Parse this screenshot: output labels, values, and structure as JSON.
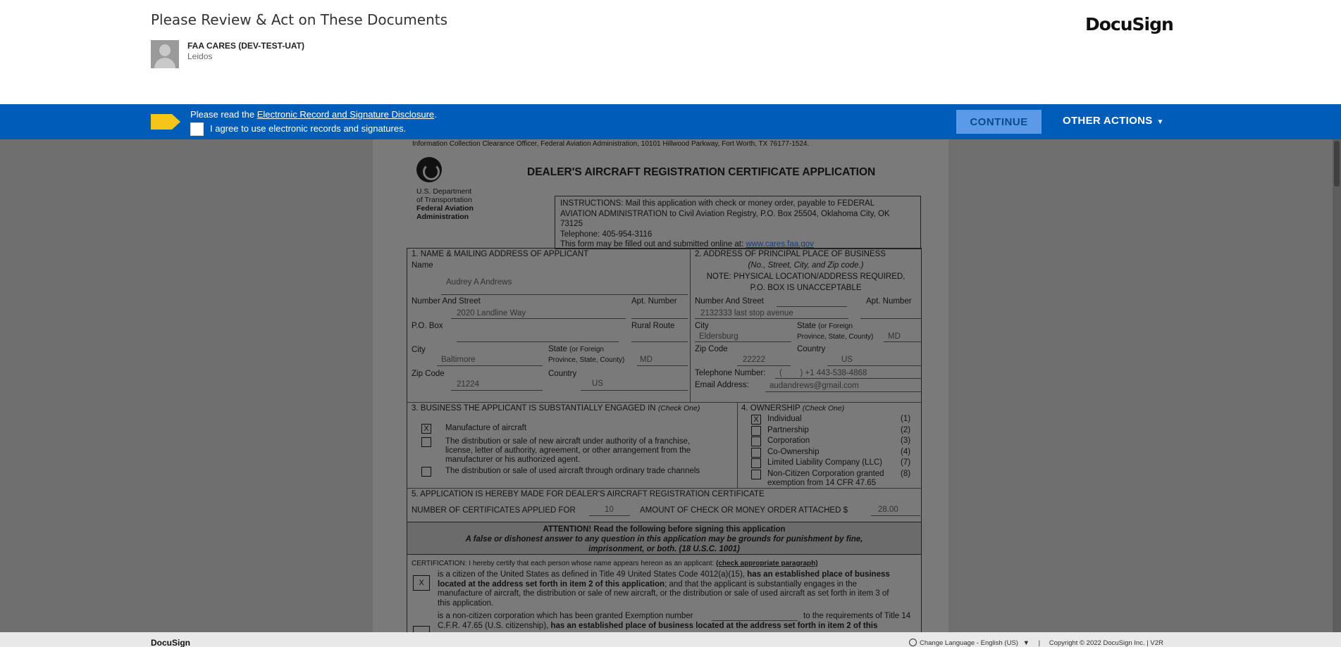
{
  "header": {
    "title": "Please Review & Act on These Documents",
    "sender_name": "FAA CARES (DEV-TEST-UAT)",
    "sender_org": "Leidos",
    "logo": "DocuSign"
  },
  "bar": {
    "read_prefix": "Please read the ",
    "disclosure_link": "Electronic Record and Signature Disclosure",
    "read_suffix": ".",
    "agree_label": "I agree to use electronic records and signatures.",
    "continue_label": "CONTINUE",
    "other_actions_label": "OTHER ACTIONS",
    "caret": "▼",
    "colors": {
      "bar": "#005cb9",
      "tag": "#f5c518"
    }
  },
  "document": {
    "info_line": "Information Collection Clearance Officer, Federal Aviation Administration, 10101 Hillwood Parkway, Fort Worth, TX 76177-1524.",
    "dept_line1": "U.S. Department",
    "dept_line2": "of Transportation",
    "dept_line3": "Federal Aviation",
    "dept_line4": "Administration",
    "title": "DEALER'S AIRCRAFT REGISTRATION CERTIFICATE APPLICATION",
    "instructions_1": "INSTRUCTIONS: Mail this application with check or money order, payable to FEDERAL",
    "instructions_2": "AVIATION ADMINISTRATION to Civil Aviation Registry, P.O. Box 25504, Oklahoma City, OK",
    "instructions_3": "73125",
    "telephone": "Telephone: 405-954-3116",
    "online_prefix": "This form may be filled out and submitted online at: ",
    "online_url": "www.cares.faa.gov",
    "s1": {
      "heading": "1.     NAME & MAILING ADDRESS OF APPLICANT",
      "name_label": "Name",
      "name_value": "Audrey A Andrews",
      "street_label": "Number And Street",
      "apt_label": "Apt. Number",
      "street_value": "2020 Landline Way",
      "pobox_label": "P.O. Box",
      "rural_label": "Rural Route",
      "city_label": "City",
      "city_value": "Baltimore",
      "state_label": "State",
      "state_sub1": "(or Foreign",
      "state_sub2": "Province, State, County)",
      "state_value": "MD",
      "zip_label": "Zip Code",
      "zip_value": "21224",
      "country_label": "Country",
      "country_value": "US"
    },
    "s2": {
      "heading": "2.     ADDRESS OF PRINCIPAL PLACE OF BUSINESS",
      "sub": "(No., Street, City, and Zip code.)",
      "note1": "NOTE: PHYSICAL LOCATION/ADDRESS REQUIRED,",
      "note2": "P.O. BOX IS UNACCEPTABLE",
      "street_label": "Number And Street",
      "apt_label": "Apt. Number",
      "street_value": "2132333 last stop avenue",
      "city_label": "City",
      "city_value": "Eldersburg",
      "state_label": "State",
      "state_sub1": "(or Foreign",
      "state_sub2": "Province, State, County)",
      "state_value": "MD",
      "zip_label": "Zip Code",
      "zip_value": "22222",
      "country_label": "Country",
      "country_value": "US",
      "phone_label": "Telephone Number:",
      "phone_value": "(        ) +1 443-538-4868",
      "email_label": "Email Address:",
      "email_value": "audandrews@gmail.com"
    },
    "s3": {
      "heading": "3.     BUSINESS THE APPLICANT IS SUBSTANTIALLY ENGAGED IN",
      "check_one": "(Check One)",
      "opt1": "Manufacture of aircraft",
      "opt1_mark": "X",
      "opt2_1": "The distribution or sale of new aircraft under authority of a franchise,",
      "opt2_2": "license, letter of authority, agreement, or other arrangement from the",
      "opt2_3": "manufacturer or his authorized agent.",
      "opt3": "The distribution or sale of used aircraft through ordinary trade channels"
    },
    "s4": {
      "heading": "4.     OWNERSHIP",
      "check_one": "(Check One)",
      "mark": "X",
      "options": [
        {
          "label": "Individual",
          "code": "(1)"
        },
        {
          "label": "Partnership",
          "code": "(2)"
        },
        {
          "label": "Corporation",
          "code": "(3)"
        },
        {
          "label": "Co-Ownership",
          "code": "(4)"
        },
        {
          "label": "Limited Liability Company (LLC)",
          "code": "(7)"
        },
        {
          "label": "Non-Citizen Corporation granted",
          "code": "(8)"
        }
      ],
      "opt6_line2": "exemption from 14 CFR 47.65"
    },
    "s5": {
      "heading": "5.     APPLICATION IS HEREBY MADE FOR DEALER'S AIRCRAFT REGISTRATION CERTIFICATE",
      "num_label": "NUMBER OF CERTIFICATES APPLIED FOR",
      "num_value": "10",
      "amount_label": "AMOUNT OF CHECK OR MONEY ORDER ATTACHED $",
      "amount_value": "28.00"
    },
    "attention": {
      "line1": "ATTENTION! Read the following before signing this application",
      "line2": "A false or dishonest answer to any question in this application may be grounds for punishment by fine,",
      "line3": "imprisonment, or both. (18 U.S.C. 1001)"
    },
    "cert": {
      "intro": "CERTIFICATION: I hereby certify that each person whose name appears hereon as an applicant: ",
      "intro_link": "(check appropriate paragraph)",
      "mark": "X",
      "p1_a": "is a citizen of the United States as defined in Title 49 United States Code 4012(a)(15), ",
      "p1_b": "has an established place of business",
      "p1_c": "located at the address set forth in item 2 of this application",
      "p1_d": "; and that the applicant is substantially engages in the",
      "p1_e": "manufacture of aircraft, the distribution or sale of new aircraft, or the distribution or sale of used aircraft as set forth in item 3 of",
      "p1_f": "this application.",
      "p2_a": "is a non-citizen corporation which has been granted Exemption number",
      "p2_b": "to the requirements of Title 14",
      "p2_c": "C.F.R. 47.65 (U.S. citizenship), ",
      "p2_d": "has an established place of business located at the address set forth in item 2 of this"
    }
  },
  "footer": {
    "logo": "DocuSign",
    "language": "Change Language - English (US)",
    "lang_caret": "▼",
    "separator": "|",
    "copyright": "Copyright © 2022 DocuSign Inc.",
    "version": "V2R"
  }
}
